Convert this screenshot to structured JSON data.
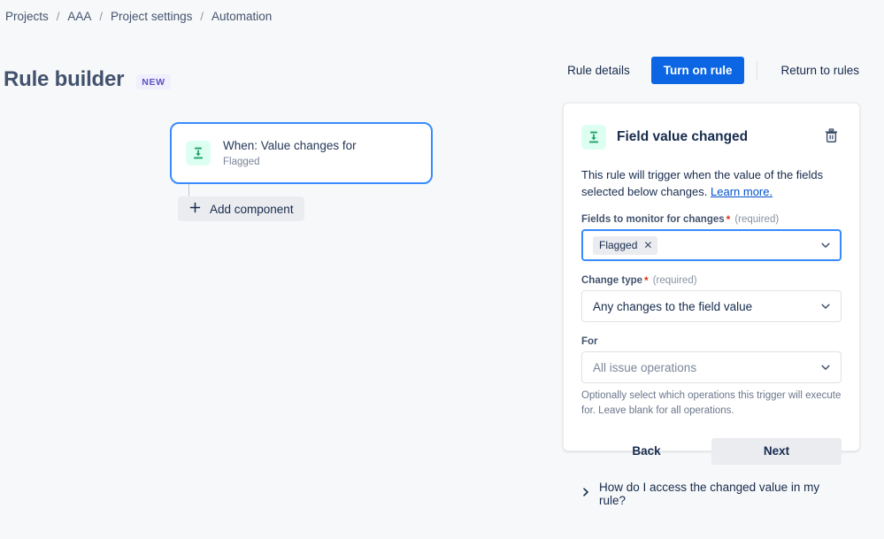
{
  "breadcrumb": {
    "items": [
      "Projects",
      "AAA",
      "Project settings",
      "Automation"
    ],
    "separator": "/"
  },
  "header": {
    "title": "Rule builder",
    "badge": "NEW",
    "rule_details_label": "Rule details",
    "turn_on_label": "Turn on rule",
    "return_label": "Return to rules"
  },
  "canvas": {
    "trigger_card": {
      "icon": "field-value-changed-icon",
      "title": "When: Value changes for",
      "subtitle": "Flagged"
    },
    "add_component_label": "Add component",
    "add_icon": "plus-icon"
  },
  "panel": {
    "icon": "field-value-changed-icon",
    "title": "Field value changed",
    "delete_icon": "trash-icon",
    "description": "This rule will trigger when the value of the fields selected below changes.",
    "learn_more": "Learn more.",
    "fields_label": "Fields to monitor for changes",
    "fields_required_marker": "*",
    "fields_required_text": "(required)",
    "fields_chips": [
      "Flagged"
    ],
    "chip_remove_icon": "close-icon",
    "change_type_label": "Change type",
    "change_type_required_marker": "*",
    "change_type_required_text": "(required)",
    "change_type_value": "Any changes to the field value",
    "for_label": "For",
    "for_value": "All issue operations",
    "for_help": "Optionally select which operations this trigger will execute for. Leave blank for all operations.",
    "back_label": "Back",
    "next_label": "Next",
    "expander_label": "How do I access the changed value in my rule?",
    "expander_icon": "chevron-right-icon",
    "dropdown_icon": "chevron-down-icon"
  },
  "colors": {
    "primary_blue": "#0c66e4",
    "focus_blue": "#388bff",
    "link_blue": "#0052cc",
    "icon_green": "#22a06b",
    "icon_green_bg": "#dcfff1",
    "badge_purple": "#5b53c4",
    "badge_purple_bg": "#f0effd",
    "page_bg": "#f7f8f9",
    "required_red": "#de350b"
  }
}
